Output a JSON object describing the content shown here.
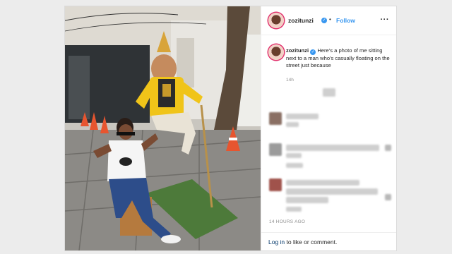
{
  "post": {
    "username": "zozitunzi",
    "verified_icon": "verified-badge-icon",
    "separator": "•",
    "follow_label": "Follow",
    "more_icon": "more-options-icon",
    "more_glyph": "···",
    "caption_username": "zozitunzi",
    "caption_text": "Here's a photo of me sitting next to a man who's casually floating on the street just because",
    "caption_time": "14h",
    "post_time": "14 HOURS AGO",
    "login_link": "Log in",
    "login_rest": " to like or comment."
  },
  "colors": {
    "accent": "#3897f0",
    "text": "#262626",
    "muted": "#8e8e8e",
    "border": "#dbdbdb"
  }
}
